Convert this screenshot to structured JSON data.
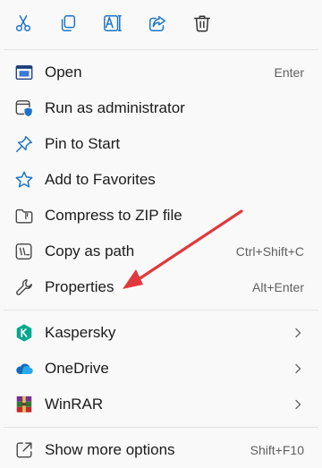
{
  "toolbar": {
    "buttons": [
      {
        "name": "cut",
        "icon": "scissors-icon"
      },
      {
        "name": "copy",
        "icon": "copy-icon"
      },
      {
        "name": "rename",
        "icon": "rename-icon"
      },
      {
        "name": "share",
        "icon": "share-icon"
      },
      {
        "name": "delete",
        "icon": "trash-icon"
      }
    ],
    "accent": "#1a73c8"
  },
  "menu": {
    "items": [
      {
        "label": "Open",
        "shortcut": "Enter",
        "icon": "open-window-icon"
      },
      {
        "label": "Run as administrator",
        "shortcut": "",
        "icon": "admin-shield-icon"
      },
      {
        "label": "Pin to Start",
        "shortcut": "",
        "icon": "pin-icon"
      },
      {
        "label": "Add to Favorites",
        "shortcut": "",
        "icon": "star-icon"
      },
      {
        "label": "Compress to ZIP file",
        "shortcut": "",
        "icon": "zip-folder-icon"
      },
      {
        "label": "Copy as path",
        "shortcut": "Ctrl+Shift+C",
        "icon": "copy-path-icon"
      },
      {
        "label": "Properties",
        "shortcut": "Alt+Enter",
        "icon": "wrench-icon"
      }
    ],
    "submenus": [
      {
        "label": "Kaspersky",
        "icon": "kaspersky-icon"
      },
      {
        "label": "OneDrive",
        "icon": "onedrive-cloud-icon"
      },
      {
        "label": "WinRAR",
        "icon": "winrar-icon"
      }
    ],
    "more": {
      "label": "Show more options",
      "shortcut": "Shift+F10",
      "icon": "external-open-icon"
    }
  },
  "annotation": {
    "type": "arrow",
    "color": "#e0393e",
    "points_to": "Properties"
  }
}
